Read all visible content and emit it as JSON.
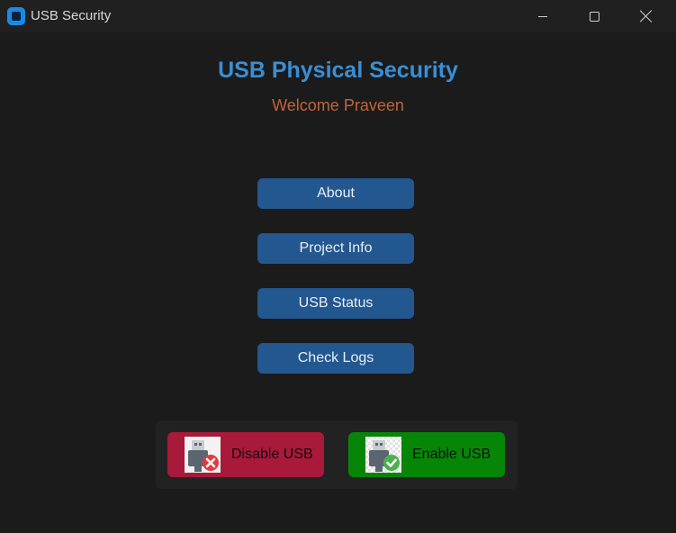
{
  "window": {
    "title": "USB Security",
    "icon": "app-icon",
    "controls": [
      "minimize-icon",
      "maximize-icon",
      "close-icon"
    ]
  },
  "header": {
    "title": "USB Physical Security",
    "subtitle": "Welcome Praveen"
  },
  "menu": {
    "about": "About",
    "project_info": "Project Info",
    "usb_status": "USB Status",
    "check_logs": "Check Logs"
  },
  "actions": {
    "disable": {
      "label": "Disable USB",
      "icon": "usb-disable-icon"
    },
    "enable": {
      "label": "Enable USB",
      "icon": "usb-enable-icon"
    }
  },
  "colors": {
    "background": "#1b1b1b",
    "title": "#3a8fd4",
    "subtitle": "#c0653a",
    "button": "#23578f",
    "disable": "#a8193a",
    "enable": "#078507"
  }
}
